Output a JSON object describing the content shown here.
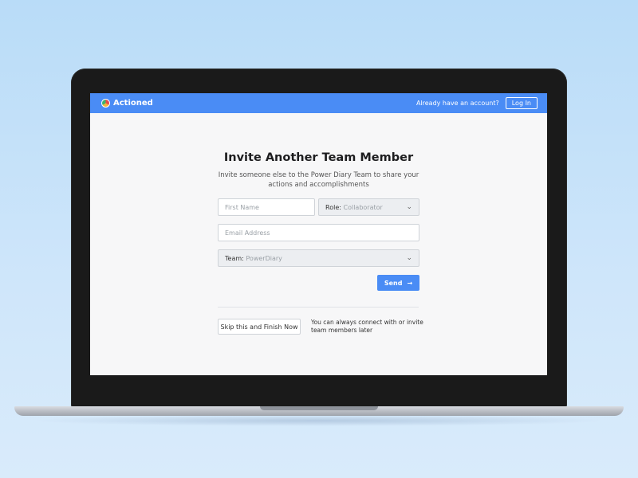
{
  "header": {
    "brand": "Actioned",
    "already_have_account": "Already have an account?",
    "login_label": "Log In"
  },
  "form": {
    "title": "Invite Another Team Member",
    "subtitle": "Invite someone else to the Power Diary Team to share your actions and accomplishments",
    "first_name_placeholder": "First Name",
    "role_label": "Role:",
    "role_value": "Collaborator",
    "email_placeholder": "Email Address",
    "team_label": "Team:",
    "team_value": "PowerDiary",
    "send_label": "Send",
    "skip_label": "Skip this and Finish Now",
    "hint": "You can always connect with or invite team members later"
  },
  "colors": {
    "accent": "#4a8cf5"
  }
}
